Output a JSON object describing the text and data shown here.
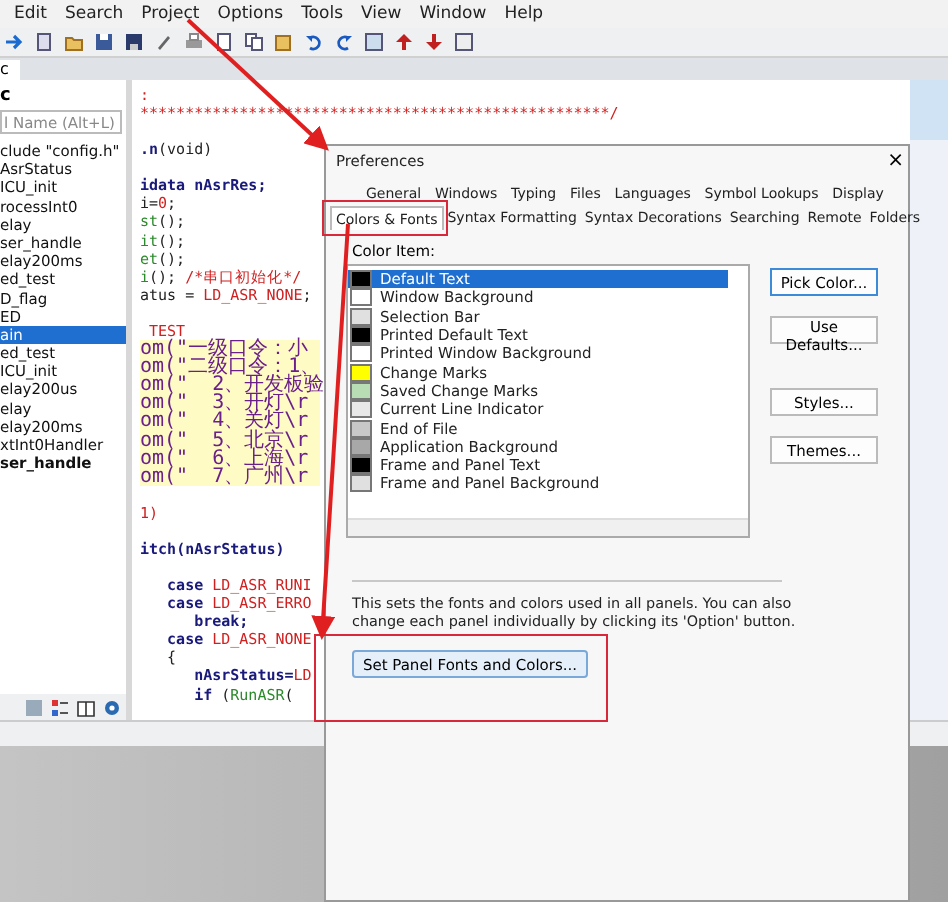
{
  "menu_bar": [
    "Edit",
    "Search",
    "Project",
    "Options",
    "Tools",
    "View",
    "Window",
    "Help"
  ],
  "file_tab": "c",
  "symbol_panel": {
    "title": "c",
    "search": {
      "placeholder": "l Name (Alt+L)"
    },
    "items": [
      {
        "label": "clude \"config.h\"",
        "selected": false,
        "bold": false
      },
      {
        "label": "AsrStatus",
        "selected": false,
        "bold": false
      },
      {
        "label": "ICU_init",
        "selected": false,
        "bold": false
      },
      {
        "label": "rocessInt0",
        "selected": false,
        "bold": false
      },
      {
        "label": "elay",
        "selected": false,
        "bold": false
      },
      {
        "label": "ser_handle",
        "selected": false,
        "bold": false
      },
      {
        "label": "elay200ms",
        "selected": false,
        "bold": false
      },
      {
        "label": "ed_test",
        "selected": false,
        "bold": false
      },
      {
        "label": "D_flag",
        "selected": false,
        "bold": false
      },
      {
        "label": "ED",
        "selected": false,
        "bold": false
      },
      {
        "label": "ain",
        "selected": true,
        "bold": false
      },
      {
        "label": "ed_test",
        "selected": false,
        "bold": false
      },
      {
        "label": "ICU_init",
        "selected": false,
        "bold": false
      },
      {
        "label": "elay200us",
        "selected": false,
        "bold": false
      },
      {
        "label": "elay",
        "selected": false,
        "bold": false
      },
      {
        "label": "elay200ms",
        "selected": false,
        "bold": false
      },
      {
        "label": "xtInt0Handler",
        "selected": false,
        "bold": false
      },
      {
        "label": "ser_handle",
        "selected": false,
        "bold": true
      }
    ]
  },
  "code_lines": [
    {
      "tokens": [
        {
          "text": ":",
          "kind": "comment"
        }
      ],
      "highlighted": false
    },
    {
      "tokens": [
        {
          "text": "****************************************************/",
          "kind": "comment"
        }
      ],
      "highlighted": false
    },
    {
      "tokens": [
        {
          "text": ".n",
          "kind": "function"
        },
        {
          "text": "(void)",
          "kind": "plain"
        }
      ],
      "highlighted": false,
      "gap_before": true
    },
    {
      "tokens": [
        {
          "text": "idata nAsrRes;",
          "kind": "keyword"
        }
      ],
      "highlighted": false,
      "gap_before": true
    },
    {
      "tokens": [
        {
          "text": "i=",
          "kind": "plain"
        },
        {
          "text": "0",
          "kind": "constant"
        },
        {
          "text": ";",
          "kind": "plain"
        }
      ],
      "highlighted": false
    },
    {
      "tokens": [
        {
          "text": "st",
          "kind": "call"
        },
        {
          "text": "();",
          "kind": "plain"
        }
      ],
      "highlighted": false
    },
    {
      "tokens": [
        {
          "text": "it",
          "kind": "call"
        },
        {
          "text": "();",
          "kind": "plain"
        }
      ],
      "highlighted": false
    },
    {
      "tokens": [
        {
          "text": "et",
          "kind": "call"
        },
        {
          "text": "();",
          "kind": "plain"
        }
      ],
      "highlighted": false
    },
    {
      "tokens": [
        {
          "text": "i",
          "kind": "call"
        },
        {
          "text": "(); ",
          "kind": "plain"
        },
        {
          "text": "/*串口初始化*/",
          "kind": "comment"
        }
      ],
      "highlighted": false
    },
    {
      "tokens": [
        {
          "text": "atus = ",
          "kind": "plain"
        },
        {
          "text": "LD_ASR_NONE",
          "kind": "constant"
        },
        {
          "text": ";",
          "kind": "plain"
        }
      ],
      "highlighted": false
    },
    {
      "tokens": [
        {
          "text": " TEST",
          "kind": "constant"
        }
      ],
      "highlighted": false,
      "gap_before": true
    },
    {
      "tokens": [
        {
          "text": "om(\"一级口令：小",
          "kind": "string"
        }
      ],
      "highlighted": true
    },
    {
      "tokens": [
        {
          "text": "om(\"二级口令：1、",
          "kind": "string"
        }
      ],
      "highlighted": true
    },
    {
      "tokens": [
        {
          "text": "om(\"  2、开发板验",
          "kind": "string"
        }
      ],
      "highlighted": true
    },
    {
      "tokens": [
        {
          "text": "om(\"  3、开灯\\r",
          "kind": "string"
        }
      ],
      "highlighted": true
    },
    {
      "tokens": [
        {
          "text": "om(\"  4、关灯\\r",
          "kind": "string"
        }
      ],
      "highlighted": true
    },
    {
      "tokens": [
        {
          "text": "om(\"  5、北京\\r",
          "kind": "string"
        }
      ],
      "highlighted": true
    },
    {
      "tokens": [
        {
          "text": "om(\"  6、上海\\r",
          "kind": "string"
        }
      ],
      "highlighted": true
    },
    {
      "tokens": [
        {
          "text": "om(\"  7、广州\\r",
          "kind": "string"
        }
      ],
      "highlighted": true
    },
    {
      "tokens": [
        {
          "text": "1)",
          "kind": "constant"
        }
      ],
      "highlighted": false,
      "gap_before": true
    },
    {
      "tokens": [
        {
          "text": "itch",
          "kind": "keyword"
        },
        {
          "text": "(nAsrStatus)",
          "kind": "function"
        }
      ],
      "highlighted": false,
      "gap_before": true
    },
    {
      "tokens": [
        {
          "text": "   case ",
          "kind": "keyword"
        },
        {
          "text": "LD_ASR_RUNI",
          "kind": "constant"
        }
      ],
      "highlighted": false,
      "gap_before": true
    },
    {
      "tokens": [
        {
          "text": "   case ",
          "kind": "keyword"
        },
        {
          "text": "LD_ASR_ERRO",
          "kind": "constant"
        }
      ],
      "highlighted": false
    },
    {
      "tokens": [
        {
          "text": "      break;",
          "kind": "keyword"
        }
      ],
      "highlighted": false
    },
    {
      "tokens": [
        {
          "text": "   case ",
          "kind": "keyword"
        },
        {
          "text": "LD_ASR_NONE",
          "kind": "constant"
        }
      ],
      "highlighted": false
    },
    {
      "tokens": [
        {
          "text": "   {",
          "kind": "plain"
        }
      ],
      "highlighted": false
    },
    {
      "tokens": [
        {
          "text": "      nAsrStatus=",
          "kind": "function"
        },
        {
          "text": "LD",
          "kind": "constant"
        }
      ],
      "highlighted": false
    },
    {
      "tokens": [
        {
          "text": "      if ",
          "kind": "keyword"
        },
        {
          "text": "(",
          "kind": "plain"
        },
        {
          "text": "RunASR",
          "kind": "call"
        },
        {
          "text": "(",
          "kind": "plain"
        }
      ],
      "highlighted": false
    }
  ],
  "dialog": {
    "title": "Preferences",
    "close": "×",
    "tab_rows": [
      [
        {
          "label": "General",
          "selected": false
        },
        {
          "label": "Windows",
          "selected": false
        },
        {
          "label": "Typing",
          "selected": false
        },
        {
          "label": "Files",
          "selected": false
        },
        {
          "label": "Languages",
          "selected": false
        },
        {
          "label": "Symbol Lookups",
          "selected": false
        },
        {
          "label": "Display",
          "selected": false
        }
      ],
      [
        {
          "label": "Colors & Fonts",
          "selected": true
        },
        {
          "label": "Syntax Formatting",
          "selected": false
        },
        {
          "label": "Syntax Decorations",
          "selected": false
        },
        {
          "label": "Searching",
          "selected": false
        },
        {
          "label": "Remote",
          "selected": false
        },
        {
          "label": "Folders",
          "selected": false
        }
      ]
    ],
    "color_item_label": "Color Item:",
    "color_items": [
      {
        "label": "Default Text",
        "color": "#000000",
        "selected": true
      },
      {
        "label": "Window Background",
        "color": "#ffffff",
        "selected": false
      },
      {
        "label": "Selection Bar",
        "color": "#e0e0e0",
        "selected": false
      },
      {
        "label": "Printed Default Text",
        "color": "#000000",
        "selected": false
      },
      {
        "label": "Printed Window Background",
        "color": "#ffffff",
        "selected": false
      },
      {
        "label": "Change Marks",
        "color": "#ffff00",
        "selected": false
      },
      {
        "label": "Saved Change Marks",
        "color": "#b8dcb4",
        "selected": false
      },
      {
        "label": "Current Line Indicator",
        "color": "#e8e8e8",
        "selected": false
      },
      {
        "label": "End of File",
        "color": "#c8c8c8",
        "selected": false
      },
      {
        "label": "Application Background",
        "color": "#a8a8a8",
        "selected": false
      },
      {
        "label": "Frame and Panel Text",
        "color": "#000000",
        "selected": false
      },
      {
        "label": "Frame and Panel Background",
        "color": "#e0e0e0",
        "selected": false
      }
    ],
    "side_buttons": [
      {
        "label": "Pick Color...",
        "kind": "default"
      },
      {
        "label": "Use Defaults...",
        "kind": "normal"
      },
      {
        "label": "Styles...",
        "kind": "spaced"
      },
      {
        "label": "Themes...",
        "kind": "normal"
      }
    ],
    "description": "This sets the fonts and colors used in all panels. You can also change each panel individually by clicking its 'Option' button.",
    "panel_button": "Set Panel Fonts and Colors..."
  }
}
